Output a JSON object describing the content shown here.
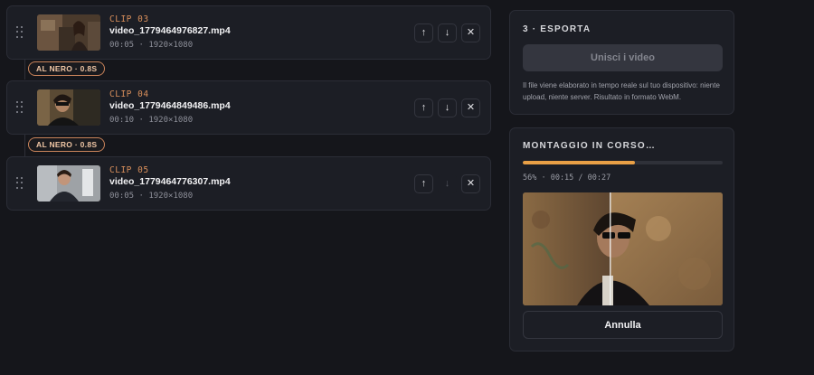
{
  "clips": [
    {
      "label": "CLIP 03",
      "name": "video_1779464976827.mp4",
      "meta": "00:05 · 1920×1080",
      "up_enabled": true,
      "down_enabled": true
    },
    {
      "label": "CLIP 04",
      "name": "video_1779464849486.mp4",
      "meta": "00:10 · 1920×1080",
      "up_enabled": true,
      "down_enabled": true
    },
    {
      "label": "CLIP 05",
      "name": "video_1779464776307.mp4",
      "meta": "00:05 · 1920×1080",
      "up_enabled": true,
      "down_enabled": false
    }
  ],
  "transitions": [
    {
      "label": "AL NERO · 0.8S"
    },
    {
      "label": "AL NERO · 0.8S"
    }
  ],
  "icons": {
    "up": "↑",
    "down": "↓",
    "remove": "✕"
  },
  "export": {
    "title": "3 · ESPORTA",
    "merge_label": "Unisci i video",
    "description": "Il file viene elaborato in tempo reale sul tuo dispositivo: niente upload, niente server. Risultato in formato WebM."
  },
  "montage": {
    "title": "MONTAGGIO IN CORSO…",
    "progress_percent": 56,
    "progress_text": "56% · 00:15 / 00:27",
    "cancel_label": "Annulla"
  },
  "colors": {
    "accent": "#e9a046",
    "clip_label": "#d98f5b",
    "transition_border": "#c9835a"
  }
}
